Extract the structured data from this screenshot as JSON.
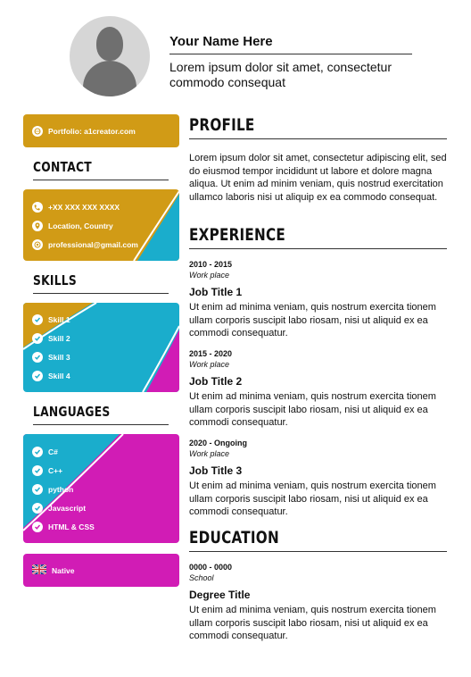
{
  "header": {
    "name": "Your Name Here",
    "tagline": "Lorem ipsum dolor sit amet, consectetur commodo consequat"
  },
  "portfolio": {
    "text": "Portfolio: a1creator.com",
    "icon": "globe-icon"
  },
  "contact": {
    "title": "CONTACT",
    "items": [
      {
        "text": "+XX XXX XXX XXXX",
        "icon": "phone-icon"
      },
      {
        "text": "Location, Country",
        "icon": "location-pin-icon"
      },
      {
        "text": "professional@gmail.com",
        "icon": "at-icon"
      }
    ]
  },
  "skills": {
    "title": "SKILLS",
    "items": [
      "Skill 1",
      "Skill 2",
      "Skill 3",
      "Skill 4"
    ]
  },
  "languages_section": {
    "title": "LANGUAGES",
    "items": [
      "C#",
      "C++",
      "python",
      "Javascript",
      "HTML & CSS"
    ]
  },
  "native": {
    "text": "Native",
    "icon": "uk-flag-icon"
  },
  "profile": {
    "title": "PROFILE",
    "text": "Lorem ipsum dolor sit amet, consectetur adipiscing elit, sed do eiusmod tempor incididunt ut labore et dolore magna aliqua. Ut enim ad minim veniam, quis nostrud exercitation ullamco laboris nisi ut aliquip ex ea commodo consequat."
  },
  "experience": {
    "title": "EXPERIENCE",
    "jobs": [
      {
        "dates": "2010 - 2015",
        "place": "Work place",
        "title": "Job Title 1",
        "text": "Ut enim ad minima veniam, quis nostrum exercita tionem ullam corporis suscipit labo riosam, nisi ut aliquid ex ea commodi consequatur."
      },
      {
        "dates": "2015 - 2020",
        "place": "Work place",
        "title": "Job Title 2",
        "text": "Ut enim ad minima veniam, quis nostrum exercita tionem ullam corporis suscipit labo riosam, nisi ut aliquid ex ea commodi consequatur."
      },
      {
        "dates": "2020 - Ongoing",
        "place": "Work place",
        "title": "Job Title 3",
        "text": "Ut enim ad minima veniam, quis nostrum exercita tionem ullam corporis suscipit labo riosam, nisi ut aliquid ex ea commodi consequatur."
      }
    ]
  },
  "education": {
    "title": "EDUCATION",
    "dates": "0000 - 0000",
    "school": "School",
    "degree": "Degree Title",
    "text": "Ut enim ad minima veniam, quis nostrum exercita tionem ullam corporis suscipit labo riosam, nisi ut aliquid ex ea commodi consequatur."
  },
  "colors": {
    "gold": "#d19b16",
    "cyan": "#1aadcc",
    "magenta": "#d11cb5"
  }
}
